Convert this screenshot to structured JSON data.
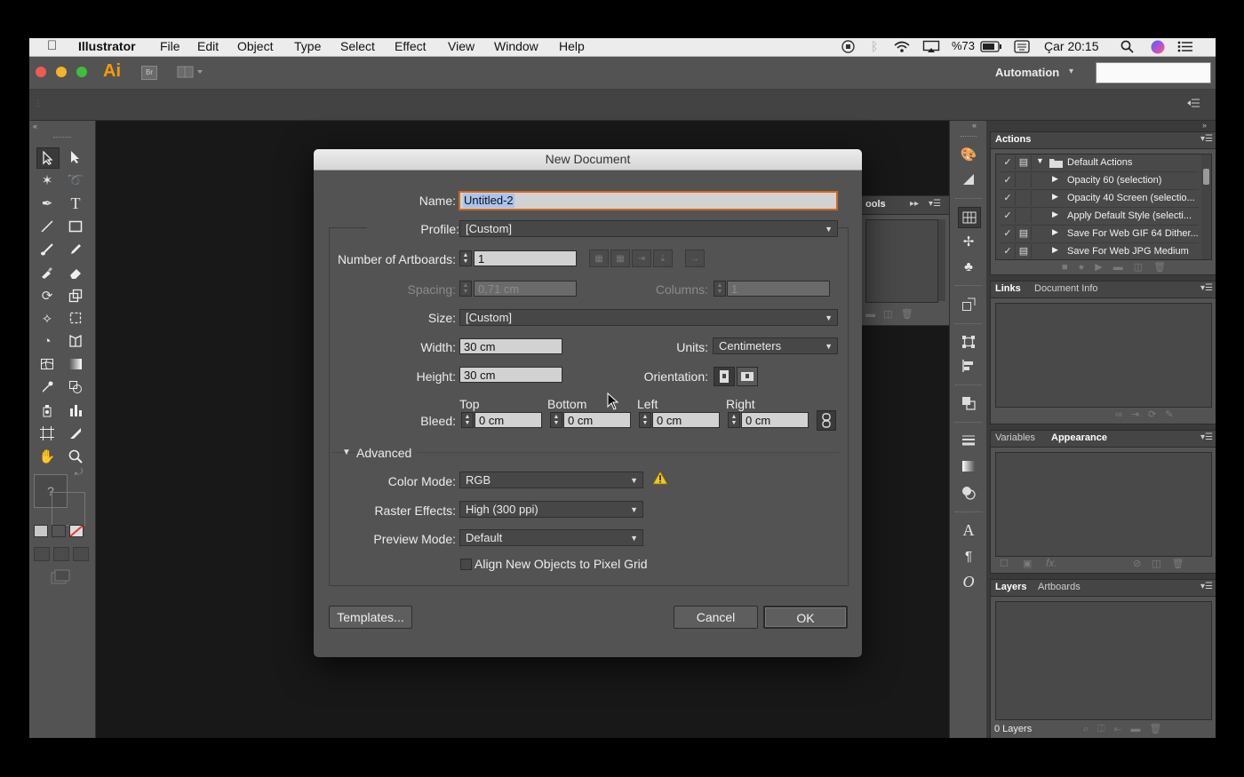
{
  "menubar": {
    "app": "Illustrator",
    "items": [
      "File",
      "Edit",
      "Object",
      "Type",
      "Select",
      "Effect",
      "View",
      "Window",
      "Help"
    ],
    "battery": "%73",
    "clock": "Çar 20:15"
  },
  "appbar": {
    "logo": "Ai",
    "bridge": "Br",
    "workspace": "Automation",
    "workspace_arrow": "▾"
  },
  "panels": {
    "actions": {
      "tab": "Actions",
      "set_name": "Default Actions",
      "items": [
        "Opacity 60 (selection)",
        "Opacity 40 Screen (selectio...",
        "Apply Default Style (selecti...",
        "Save For Web GIF 64 Dither...",
        "Save For Web JPG Medium"
      ]
    },
    "links": {
      "tabs": [
        "Links",
        "Document Info"
      ]
    },
    "appearance": {
      "tabs": [
        "Variables",
        "Appearance"
      ],
      "fx": "fx."
    },
    "layers": {
      "tabs": [
        "Layers",
        "Artboards"
      ],
      "footer": "0 Layers"
    },
    "floating": {
      "tab_fragment": "ools"
    }
  },
  "tools": {
    "help": "?"
  },
  "dialog": {
    "title": "New Document",
    "name_label": "Name:",
    "name_value": "Untitled-2",
    "profile_label": "Profile:",
    "profile_value": "[Custom]",
    "artboards_label": "Number of Artboards:",
    "artboards_value": "1",
    "spacing_label": "Spacing:",
    "spacing_value": "0,71 cm",
    "columns_label": "Columns:",
    "columns_value": "1",
    "size_label": "Size:",
    "size_value": "[Custom]",
    "width_label": "Width:",
    "width_value": "30 cm",
    "units_label": "Units:",
    "units_value": "Centimeters",
    "height_label": "Height:",
    "height_value": "30 cm",
    "orientation_label": "Orientation:",
    "bleed_label": "Bleed:",
    "bleed": [
      {
        "label": "Top",
        "value": "0 cm"
      },
      {
        "label": "Bottom",
        "value": "0 cm"
      },
      {
        "label": "Left",
        "value": "0 cm"
      },
      {
        "label": "Right",
        "value": "0 cm"
      }
    ],
    "advanced_label": "Advanced",
    "color_mode_label": "Color Mode:",
    "color_mode_value": "RGB",
    "raster_label": "Raster Effects:",
    "raster_value": "High (300 ppi)",
    "preview_label": "Preview Mode:",
    "preview_value": "Default",
    "align_label": "Align New Objects to Pixel Grid",
    "align_checked": false,
    "templates_label": "Templates...",
    "cancel_label": "Cancel",
    "ok_label": "OK"
  },
  "colors": {
    "ai_logo": "#ff9a00",
    "name_focus": "#d0671e",
    "selection": "#a9c4ee",
    "warning": "#f3c623"
  }
}
